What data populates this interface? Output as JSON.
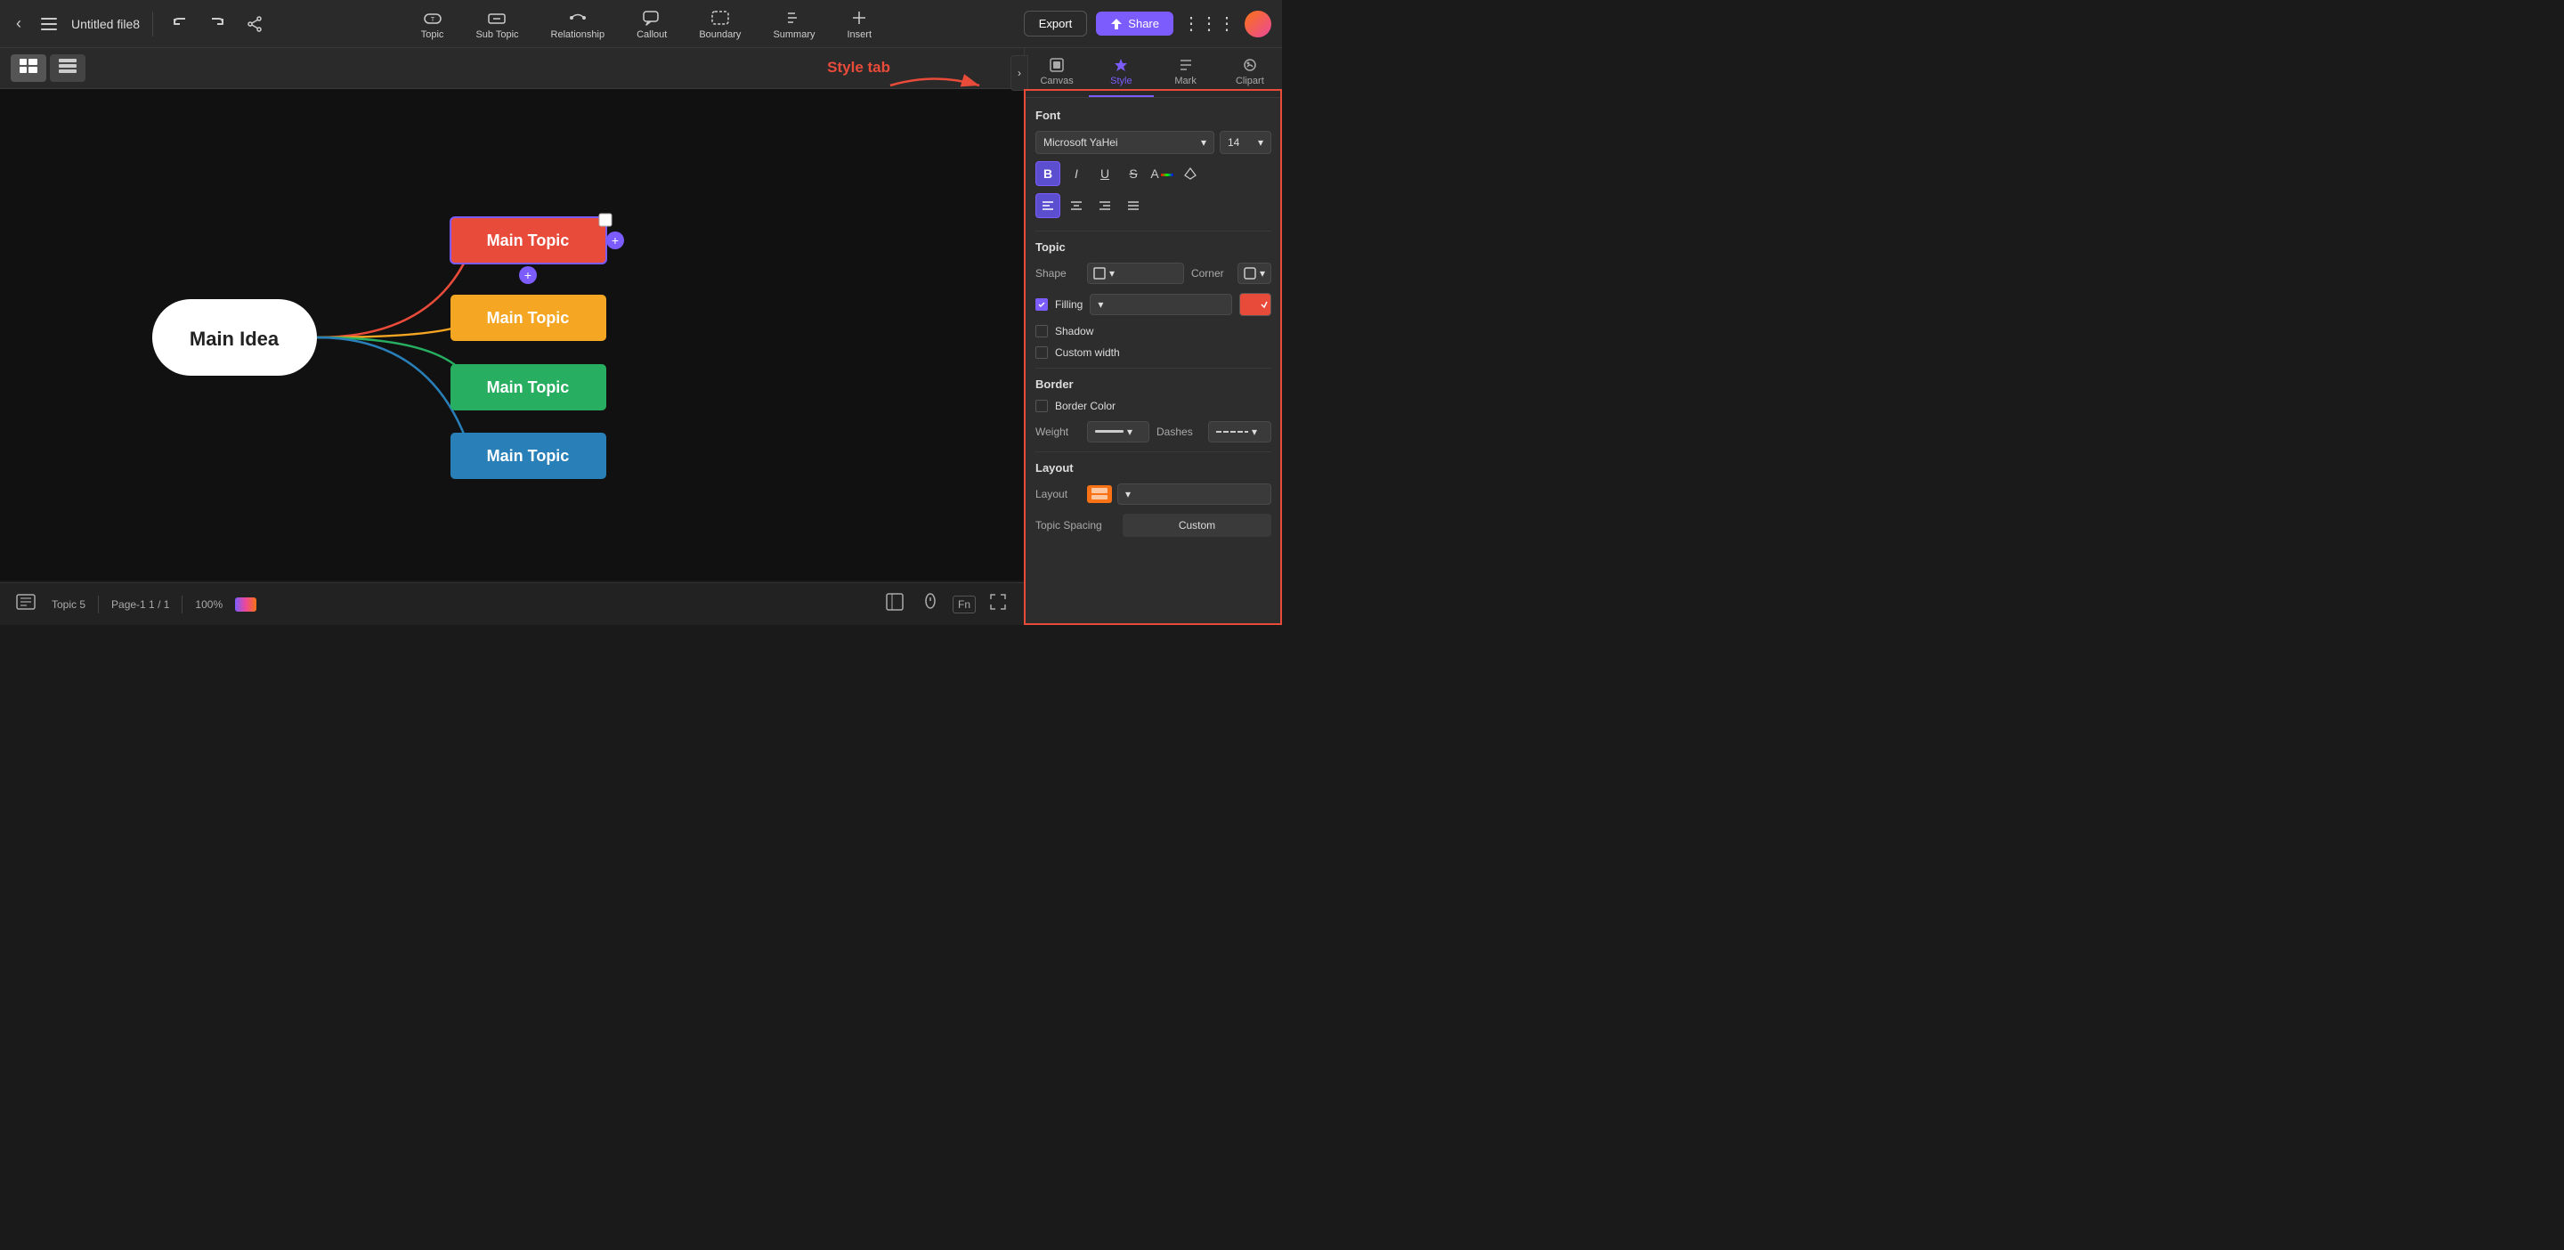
{
  "app": {
    "title": "Untitled file8"
  },
  "topbar": {
    "undo_label": "↩",
    "redo_label": "↪",
    "topic_label": "Topic",
    "subtopic_label": "Sub Topic",
    "relationship_label": "Relationship",
    "callout_label": "Callout",
    "boundary_label": "Boundary",
    "summary_label": "Summary",
    "insert_label": "Insert",
    "export_label": "Export",
    "share_label": "Share"
  },
  "panel": {
    "canvas_tab": "Canvas",
    "style_tab": "Style",
    "mark_tab": "Mark",
    "clipart_tab": "Clipart",
    "style_tab_annotation": "Style tab"
  },
  "font_section": {
    "title": "Font",
    "font_name": "Microsoft YaHei",
    "font_size": "14",
    "bold": "B",
    "italic": "I",
    "underline": "U",
    "strikethrough": "S",
    "align_left": "≡",
    "align_center": "≡",
    "align_right": "≡",
    "align_justify": "≡"
  },
  "topic_section": {
    "title": "Topic",
    "shape_label": "Shape",
    "corner_label": "Corner",
    "filling_label": "Filling",
    "shadow_label": "Shadow",
    "custom_width_label": "Custom width"
  },
  "border_section": {
    "title": "Border",
    "border_color_label": "Border Color",
    "weight_label": "Weight",
    "dashes_label": "Dashes"
  },
  "layout_section": {
    "title": "Layout",
    "layout_label": "Layout",
    "topic_spacing_label": "Topic Spacing",
    "custom_label": "Custom"
  },
  "canvas": {
    "main_idea_text": "Main Idea",
    "topic_texts": [
      "Main Topic",
      "Main Topic",
      "Main Topic",
      "Main Topic"
    ],
    "topic_colors": [
      "#e84b3a",
      "#f5a623",
      "#27ae60",
      "#2980b9"
    ]
  },
  "bottombar": {
    "topic_count": "Topic 5",
    "page_info": "Page-1  1 / 1",
    "zoom": "100%"
  }
}
